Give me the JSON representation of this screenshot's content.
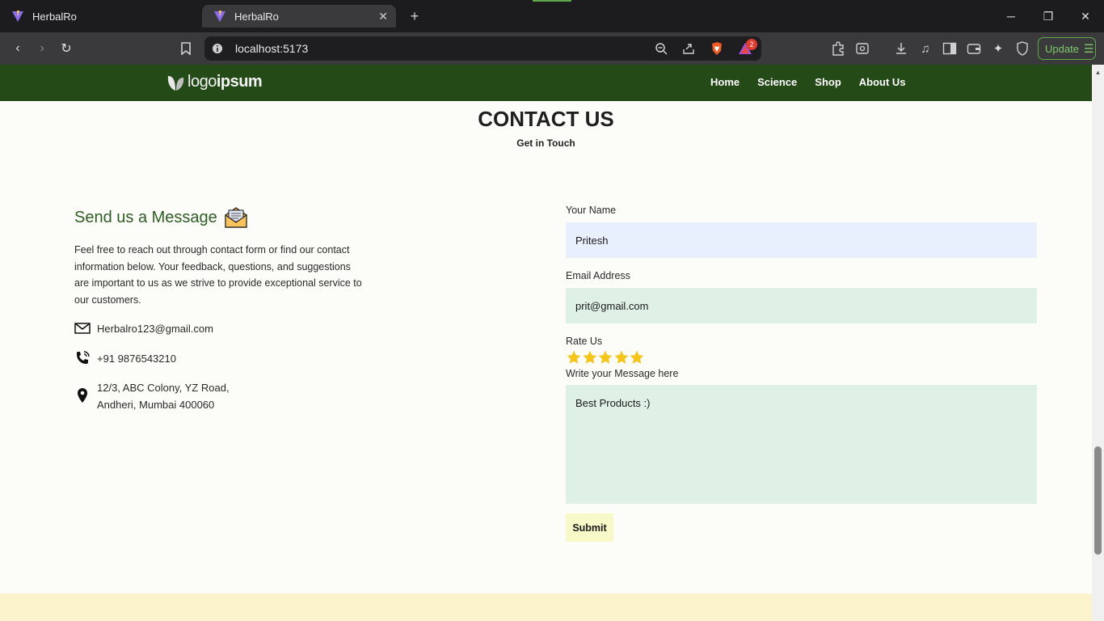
{
  "browser": {
    "tabs": [
      {
        "title": "HerbalRo",
        "active": false
      },
      {
        "title": "HerbalRo",
        "active": true
      }
    ],
    "url": "localhost:5173",
    "shields_badge": "2",
    "update_label": "Update"
  },
  "site": {
    "logo_text_light": "logo",
    "logo_text_bold": "ipsum",
    "nav": [
      "Home",
      "Science",
      "Shop",
      "About Us"
    ]
  },
  "contact": {
    "title": "CONTACT US",
    "subtitle": "Get in Touch",
    "heading": "Send us a Message",
    "intro": "Feel free to reach out through contact form or find our contact information below. Your feedback, questions, and suggestions are important to us as we strive to provide exceptional service to our customers.",
    "email": "Herbalro123@gmail.com",
    "phone": "+91 9876543210",
    "address_line1": "12/3, ABC Colony, YZ Road,",
    "address_line2": "Andheri, Mumbai 400060"
  },
  "form": {
    "name_label": "Your Name",
    "name_value": "Pritesh",
    "email_label": "Email Address",
    "email_value": "prit@gmail.com",
    "rate_label": "Rate Us",
    "rating": 5,
    "rating_max": 5,
    "message_label": "Write your Message here",
    "message_value": "Best Products :)",
    "submit_label": "Submit"
  },
  "colors": {
    "nav_bg": "#244a17",
    "heading_green": "#2f5e24",
    "star": "#f5c518",
    "submit_bg": "#f7f9c8",
    "footer_bg": "#fbf3cc"
  }
}
